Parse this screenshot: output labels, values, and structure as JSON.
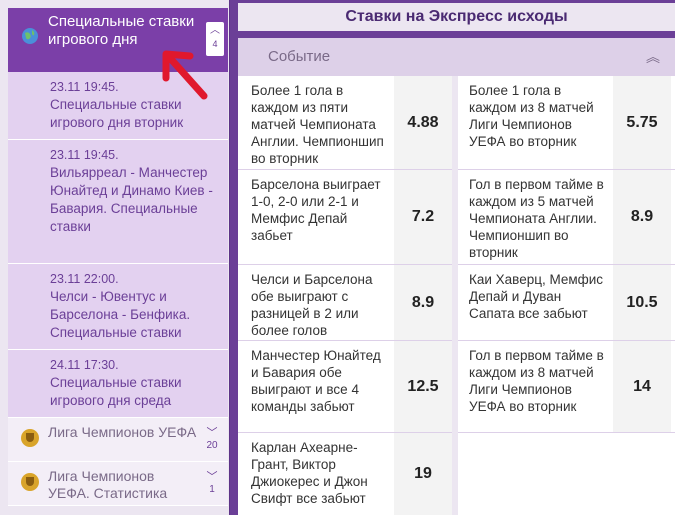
{
  "sidebar": {
    "header": {
      "title": "Специальные ставки игрового дня",
      "count": "4"
    },
    "items": [
      {
        "time": "23.11 19:45.",
        "label": "Специальные ставки игрового дня вторник"
      },
      {
        "time": "23.11 19:45.",
        "label": "Вильярреал - Манчестер Юнайтед и Динамо Киев - Бавария. Специальные ставки"
      },
      {
        "time": "23.11 22:00.",
        "label": "Челси - Ювентус и Барселона - Бенфика. Специальные ставки"
      },
      {
        "time": "24.11 17:30.",
        "label": "Специальные ставки игрового дня среда"
      }
    ],
    "leagues": [
      {
        "label": "Лига Чемпионов УЕФА",
        "count": "20"
      },
      {
        "label": "Лига Чемпионов УЕФА. Статистика",
        "count": "1"
      }
    ]
  },
  "main": {
    "title": "Ставки на Экспресс исходы",
    "column_header": "Событие",
    "left": [
      {
        "text": "Более 1 гола в каждом из пяти матчей Чемпионата Англии. Чемпионшип во вторник",
        "odd": "4.88"
      },
      {
        "text": "Барселона выиграет 1-0, 2-0 или 2-1 и Мемфис Депай забьет",
        "odd": "7.2"
      },
      {
        "text": "Челси и Барселона обе выиграют с разницей в 2 или более голов",
        "odd": "8.9"
      },
      {
        "text": "Манчестер Юнайтед и Бавария обе выиграют и все 4 команды забьют",
        "odd": "12.5"
      },
      {
        "text": "Карлан Ахеарне-Грант, Виктор Джиокерес и Джон Свифт все забьют",
        "odd": "19"
      }
    ],
    "right": [
      {
        "text": "Более 1 гола в каждом из 8 матчей Лиги Чемпионов УЕФА во вторник",
        "odd": "5.75"
      },
      {
        "text": "Гол в первом тайме в каждом из 5 матчей Чемпионата Англии. Чемпионшип во вторник",
        "odd": "8.9"
      },
      {
        "text": "Каи Хаверц, Мемфис Депай и Дуван Сапата все забьют",
        "odd": "10.5"
      },
      {
        "text": "Гол в первом тайме в каждом из 8 матчей Лиги Чемпионов УЕФА во вторник",
        "odd": "14"
      }
    ]
  },
  "colors": {
    "accent": "#7b3fa8",
    "sidebar_item": "#e3d1f0",
    "background": "#6b3f97"
  }
}
